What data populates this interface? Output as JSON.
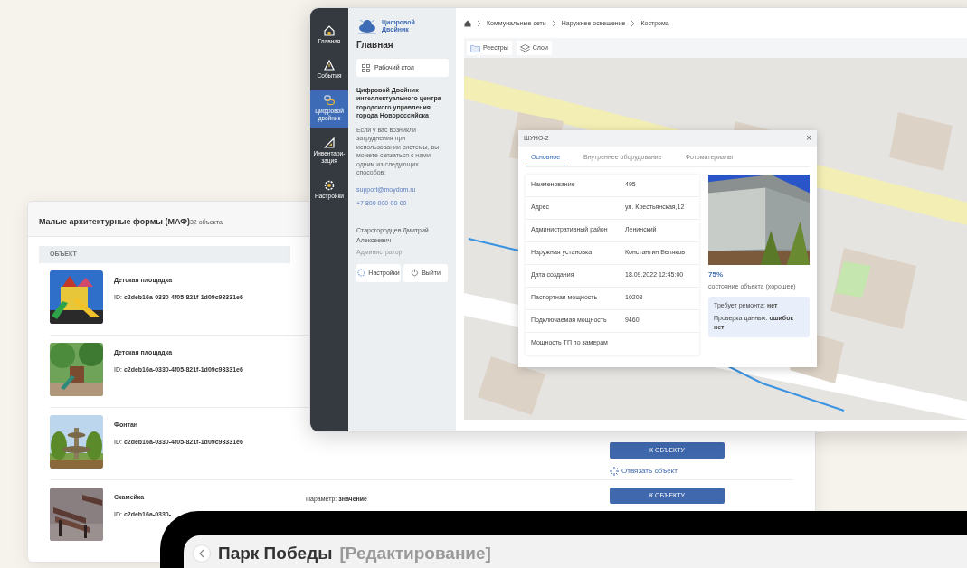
{
  "back_card": {
    "title": "Малые архитектурные формы (МАФ)",
    "count": "32 объекта",
    "columns": [
      "ОБЪЕКТ"
    ],
    "rows": [
      {
        "kind": "playground",
        "name": "Детская площадка",
        "id_label": "ID:",
        "id": "c2deb16a-0330-4f05-821f-1d09c93331e6"
      },
      {
        "kind": "park",
        "name": "Детская площадка",
        "id_label": "ID:",
        "id": "c2deb16a-0330-4f05-821f-1d09c93331e6"
      },
      {
        "kind": "fountain",
        "name": "Фонтан",
        "id_label": "ID:",
        "id": "c2deb16a-0330-4f05-821f-1d09c93331e6",
        "button": "К ОБЪЕКТУ",
        "link": "Отвязать объект"
      },
      {
        "kind": "bench",
        "name": "Скамейка",
        "id_label": "ID:",
        "id": "c2deb16a-0330-",
        "param_label": "Параметр:",
        "param_value": "значение",
        "button": "К ОБЪЕКТУ"
      }
    ]
  },
  "app": {
    "sidebar": {
      "items": [
        {
          "kind": "home",
          "label": "Главная",
          "selected": false
        },
        {
          "kind": "events",
          "label": "События",
          "selected": false
        },
        {
          "kind": "twin",
          "label": "Цифровой двойник",
          "selected": true
        },
        {
          "kind": "inventory",
          "label": "Инвентари-зация",
          "selected": false
        },
        {
          "kind": "settings",
          "label": "Настройки",
          "selected": false
        }
      ]
    },
    "panel": {
      "logo": "Цифровой Двойник",
      "heading": "Главная",
      "desk_button": "Рабочий стол",
      "org": "Цифровой Двойник интеллектуального центра городского управления города Новороссийска",
      "help": "Если у вас возникли затруднения при использовании системы, вы можете связаться с нами одним из следующих способов:",
      "email": "support@moydom.ru",
      "phone": "+7 800 000-00-00",
      "user": "Старогородцев Дмитрий Алексеевич",
      "role": "Администратор",
      "buttons": [
        {
          "kind": "settings",
          "label": "Настройки"
        },
        {
          "kind": "logout",
          "label": "Выйти"
        }
      ]
    },
    "breadcrumb": [
      "Коммунальные сети",
      "Наружнее освещение",
      "Кострома"
    ],
    "toolbar": [
      {
        "kind": "folder",
        "label": "Реестры"
      },
      {
        "kind": "layers",
        "label": "Слои"
      }
    ],
    "popup": {
      "title": "ШУНО-2",
      "close": "×",
      "tabs": [
        {
          "label": "Основное",
          "selected": true
        },
        {
          "label": "Внутреннее оборудование",
          "selected": false
        },
        {
          "label": "Фотоматериалы",
          "selected": false
        }
      ],
      "fields": [
        {
          "label": "Наименование",
          "value": "495"
        },
        {
          "label": "Адрес",
          "value": "ул. Крестьянская,12"
        },
        {
          "label": "Административный район",
          "value": "Ленинский"
        },
        {
          "label": "Наружная установка",
          "value": "Константин Беляков"
        },
        {
          "label": "Дата создания",
          "value": "18.09.2022 12:45:00"
        },
        {
          "label": "Паспортная мощность",
          "value": "10208"
        },
        {
          "label": "Подключаемая мощность",
          "value": "9460"
        },
        {
          "label": "Мощность ТП по замерам"
        }
      ],
      "percent": "75%",
      "condition": "состояние объекта (хорошее)",
      "notes": [
        "Требует ремонта: **нет**",
        "Проверка данных: **ошибок нет**"
      ]
    }
  },
  "editor": {
    "title": "Парк Победы",
    "mode": "[Редактирование]"
  }
}
